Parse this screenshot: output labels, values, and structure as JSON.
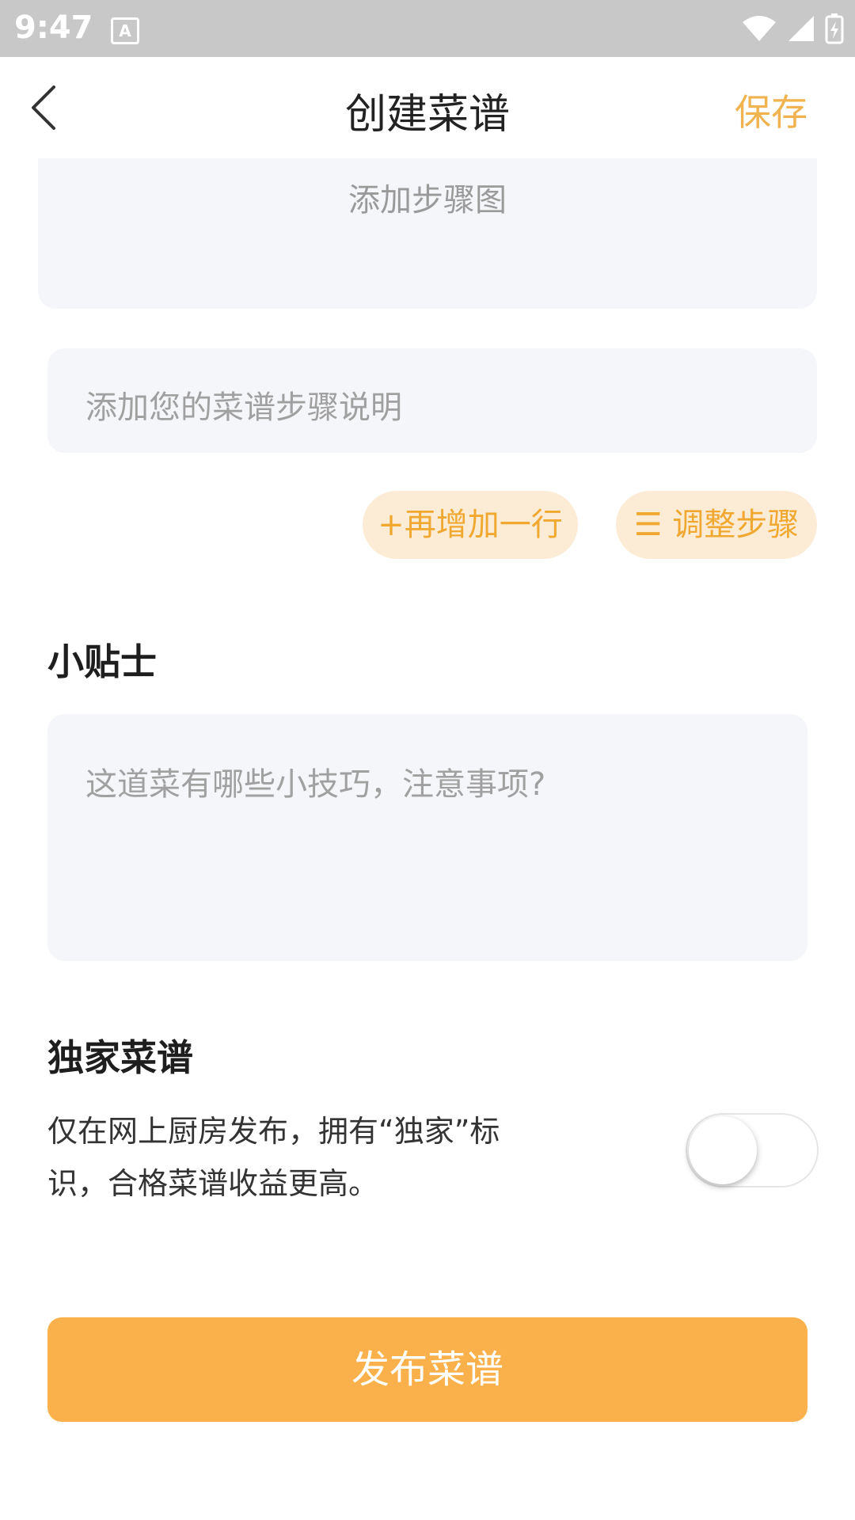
{
  "status_bar": {
    "time": "9:47",
    "notification_icon": "a-box-icon",
    "wifi_icon": "wifi-icon",
    "signal_icon": "signal-icon",
    "battery_icon": "battery-charging-icon"
  },
  "header": {
    "title": "创建菜谱",
    "save_label": "保存",
    "back_icon": "chevron-left-icon"
  },
  "step": {
    "image_label": "添加步骤图",
    "description_placeholder": "添加您的菜谱步骤说明",
    "add_row_label": "+再增加一行",
    "adjust_label": "☰ 调整步骤"
  },
  "tips": {
    "title": "小贴士",
    "placeholder": "这道菜有哪些小技巧，注意事项?"
  },
  "exclusive": {
    "title": "独家菜谱",
    "description": "仅在网上厨房发布，拥有“独家”标识，合格菜谱收益更高。",
    "toggle_on": false
  },
  "publish_label": "发布菜谱",
  "colors": {
    "accent": "#f0b350",
    "publish_button": "#fbb14b",
    "pill_bg": "#fcecd6",
    "input_bg": "#f5f6f9"
  }
}
